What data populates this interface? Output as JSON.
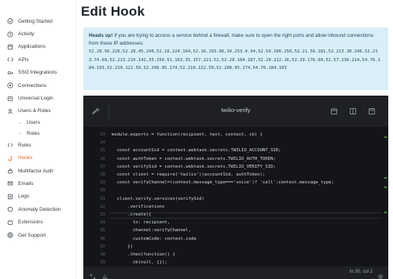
{
  "sidebar": {
    "items": [
      {
        "label": "Getting Started",
        "icon": "check-circle-icon"
      },
      {
        "label": "Activity",
        "icon": "activity-icon"
      },
      {
        "label": "Applications",
        "icon": "applications-icon"
      },
      {
        "label": "APIs",
        "icon": "api-icon"
      },
      {
        "label": "SSO Integrations",
        "icon": "sso-icon"
      },
      {
        "label": "Connections",
        "icon": "connections-icon"
      },
      {
        "label": "Universal Login",
        "icon": "universal-login-icon"
      },
      {
        "label": "Users & Roles",
        "icon": "users-icon"
      }
    ],
    "subitems": [
      {
        "label": "Users"
      },
      {
        "label": "Roles"
      }
    ],
    "items2": [
      {
        "label": "Rules",
        "icon": "rules-icon"
      },
      {
        "label": "Hooks",
        "icon": "hooks-icon",
        "active": true
      },
      {
        "label": "Multifactor Auth",
        "icon": "mfa-icon"
      },
      {
        "label": "Emails",
        "icon": "emails-icon"
      },
      {
        "label": "Logs",
        "icon": "logs-icon"
      },
      {
        "label": "Anomaly Detection",
        "icon": "anomaly-icon"
      },
      {
        "label": "Extensions",
        "icon": "extensions-icon"
      },
      {
        "label": "Get Support",
        "icon": "support-icon"
      }
    ],
    "active_color": "#e8622a"
  },
  "page": {
    "title": "Edit Hook"
  },
  "alert": {
    "heading": "Heads up!",
    "message": " If you are trying to access a service behind a firewall, make sure to open the right ports and allow inbound connections from these IP addresses: ",
    "ips": "52.28.56.226,52.28.45.240,52.16.224.164,52.16.193.66,34.253.4.94,52.50.106.250,52.21.56.181,52.213.38.246,52.213.74.69,52.213.216.142,35.156.51.163,35.157.221.52,52.28.184.187,52.28.212.16,52.29.176.99,52.57.230.214,54.76.184.103,52.210.122.50,52.208.95.174,52.210.122.50,52.208.95.174,54.76.184.103"
  },
  "editor": {
    "title": "twilio-verify",
    "status": "ln 30, col 2",
    "lines": [
      {
        "n": "23",
        "text": "module.exports = function(recipient, text, context, cb) {"
      },
      {
        "n": "24",
        "text": ""
      },
      {
        "n": "25",
        "text": "  const accountSid = context.webtask.secrets.TWILIO_ACCOUNT_SID;"
      },
      {
        "n": "26",
        "text": "  const authToken = context.webtask.secrets.TWILIO_AUTH_TOKEN;"
      },
      {
        "n": "27",
        "text": "  const verifySid = context.webtask.secrets.TWILIO_VERIFY_SID;"
      },
      {
        "n": "28",
        "text": "  const client = require('twilio')(accountSid, authToken);"
      },
      {
        "n": "29",
        "text": "  const verifyChannel=(context.message_type==='voice')? 'call':context.message_type;"
      },
      {
        "n": "30",
        "text": ""
      },
      {
        "n": "31",
        "text": "  client.verify.services(verifySid)"
      },
      {
        "n": "32",
        "text": "      .verifications"
      },
      {
        "n": "33",
        "text": "      .create({"
      },
      {
        "n": "34",
        "text": "        to: recipient,"
      },
      {
        "n": "35",
        "text": "        channel:verifyChannel,"
      },
      {
        "n": "36",
        "text": "        customCode: context.code"
      },
      {
        "n": "37",
        "text": "      })"
      },
      {
        "n": "38",
        "text": "      .then(function() {"
      },
      {
        "n": "39",
        "text": "        cb(null, {});"
      },
      {
        "n": "40",
        "text": "      })"
      }
    ]
  }
}
